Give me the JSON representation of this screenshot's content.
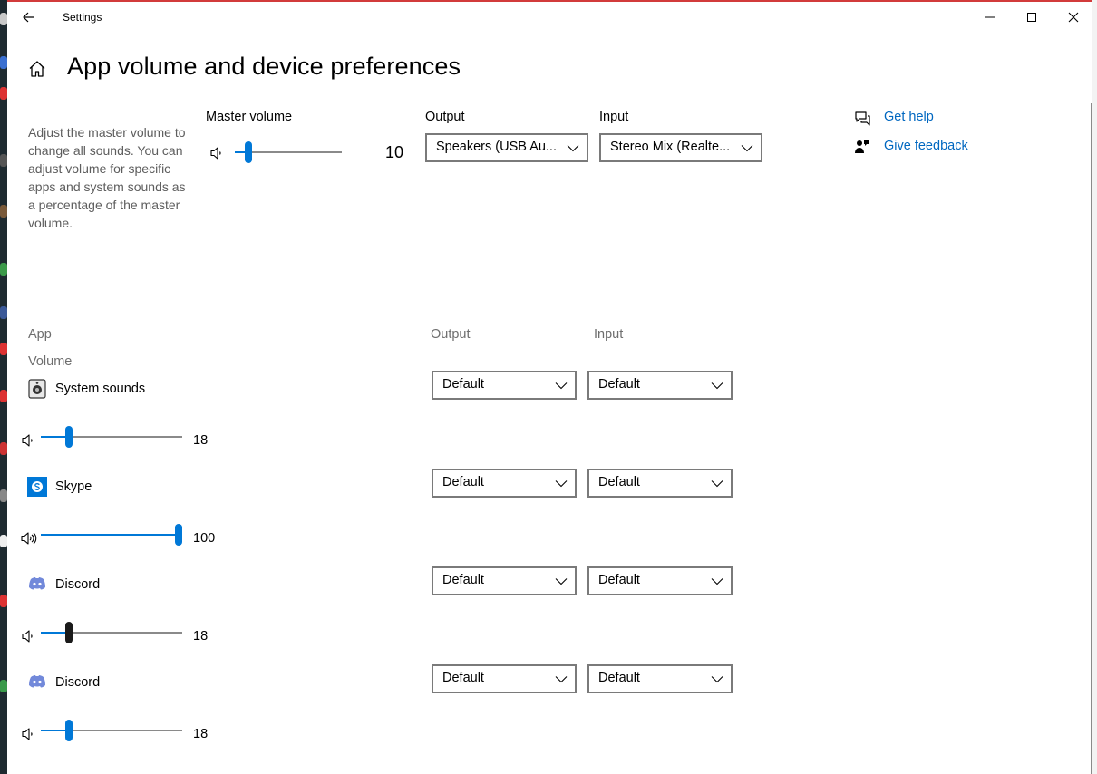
{
  "window": {
    "title": "Settings"
  },
  "page": {
    "title": "App volume and device preferences",
    "description": "Adjust the master volume to change all sounds. You can adjust volume for specific apps and system sounds as a percentage of the master volume."
  },
  "master": {
    "label": "Master volume",
    "value": "10",
    "level": 0.1,
    "output_label": "Output",
    "output_value": "Speakers (USB Au...",
    "input_label": "Input",
    "input_value": "Stereo Mix (Realte..."
  },
  "help": {
    "get_help": "Get help",
    "give_feedback": "Give feedback"
  },
  "apps_header": {
    "app": "App",
    "volume": "Volume",
    "output": "Output",
    "input": "Input"
  },
  "apps": [
    {
      "name": "System sounds",
      "value": "18",
      "level": 0.18,
      "output": "Default",
      "input": "Default",
      "icon": "system-sounds-icon"
    },
    {
      "name": "Skype",
      "value": "100",
      "level": 1.0,
      "output": "Default",
      "input": "Default",
      "icon": "skype-icon"
    },
    {
      "name": "Discord",
      "value": "18",
      "level": 0.18,
      "output": "Default",
      "input": "Default",
      "icon": "discord-icon"
    },
    {
      "name": "Discord",
      "value": "18",
      "level": 0.18,
      "output": "Default",
      "input": "Default",
      "icon": "discord-icon"
    }
  ],
  "colors": {
    "accent": "#0078d7",
    "link": "#0067c0"
  }
}
